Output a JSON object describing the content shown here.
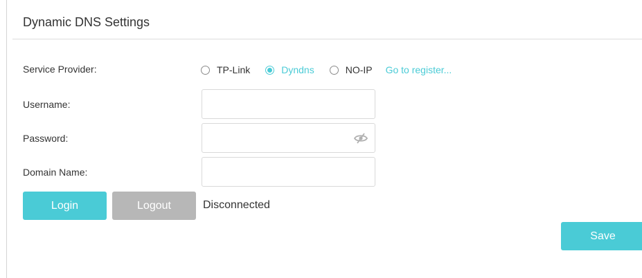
{
  "title": "Dynamic DNS Settings",
  "service_provider": {
    "label": "Service Provider:",
    "options": [
      {
        "label": "TP-Link",
        "selected": false
      },
      {
        "label": "Dyndns",
        "selected": true
      },
      {
        "label": "NO-IP",
        "selected": false
      }
    ],
    "register_link": "Go to register..."
  },
  "username": {
    "label": "Username:",
    "value": ""
  },
  "password": {
    "label": "Password:",
    "value": "",
    "toggle_icon": "eye-slash-icon"
  },
  "domain_name": {
    "label": "Domain Name:",
    "value": ""
  },
  "buttons": {
    "login": "Login",
    "logout": "Logout",
    "save": "Save"
  },
  "status": "Disconnected",
  "colors": {
    "accent": "#4acbd6",
    "disabled_button": "#b7b7b7"
  }
}
